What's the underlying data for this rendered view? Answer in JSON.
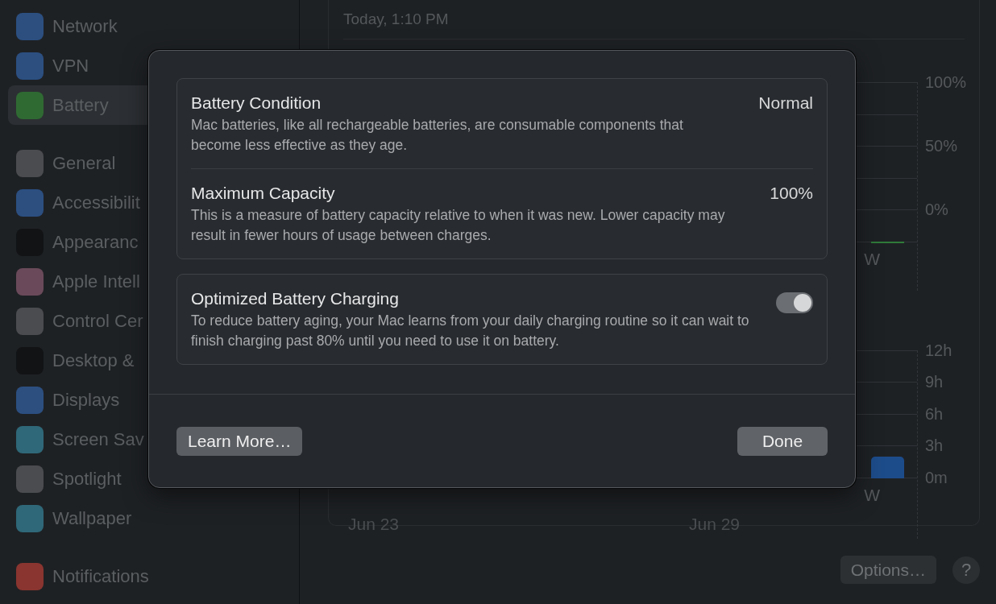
{
  "sidebar": {
    "groups": [
      {
        "items": [
          {
            "label": "Network",
            "color": "#2c4f80",
            "selected": false
          },
          {
            "label": "VPN",
            "color": "#2c4f80",
            "selected": false
          },
          {
            "label": "Battery",
            "color": "#2f6a33",
            "selected": true
          }
        ]
      },
      {
        "items": [
          {
            "label": "General",
            "color": "#4a4c4f",
            "selected": false
          },
          {
            "label": "Accessibilit",
            "color": "#2c4f80",
            "selected": false
          },
          {
            "label": "Appearanc",
            "color": "#111315",
            "selected": false
          },
          {
            "label": "Apple Intell",
            "color": "#6a4a5a",
            "selected": false
          },
          {
            "label": "Control Cer",
            "color": "#4a4c4f",
            "selected": false
          },
          {
            "label": "Desktop &",
            "color": "#111315",
            "selected": false
          },
          {
            "label": "Displays",
            "color": "#2c4f80",
            "selected": false
          },
          {
            "label": "Screen Sav",
            "color": "#2f6878",
            "selected": false
          },
          {
            "label": "Spotlight",
            "color": "#4a4c4f",
            "selected": false
          },
          {
            "label": "Wallpaper",
            "color": "#2f6878",
            "selected": false
          }
        ]
      },
      {
        "items": [
          {
            "label": "Notifications",
            "color": "#8a3530",
            "selected": false
          }
        ]
      }
    ]
  },
  "main": {
    "timestamp": "Today, 1:10 PM",
    "level_chart": {
      "tick_labels": [
        "100%",
        "50%",
        "0%"
      ],
      "day_label": "W"
    },
    "usage_chart": {
      "tick_labels": [
        "12h",
        "9h",
        "6h",
        "3h",
        "0m"
      ],
      "day_label": "W"
    },
    "dates": [
      "Jun 23",
      "Jun 29"
    ],
    "options_button": "Options…",
    "help_button": "?"
  },
  "dialog": {
    "groups": [
      {
        "rows": [
          {
            "kind": "value",
            "title": "Battery Condition",
            "value": "Normal",
            "description": "Mac batteries, like all rechargeable batteries, are consumable components that become less effective as they age."
          },
          {
            "kind": "value",
            "title": "Maximum Capacity",
            "value": "100%",
            "description": "This is a measure of battery capacity relative to when it was new. Lower capacity may result in fewer hours of usage between charges."
          }
        ]
      },
      {
        "rows": [
          {
            "kind": "toggle",
            "title": "Optimized Battery Charging",
            "on": true,
            "description": "To reduce battery aging, your Mac learns from your daily charging routine so it can wait to finish charging past 80% until you need to use it on battery."
          }
        ]
      }
    ],
    "learn_more_button": "Learn More…",
    "done_button": "Done"
  }
}
